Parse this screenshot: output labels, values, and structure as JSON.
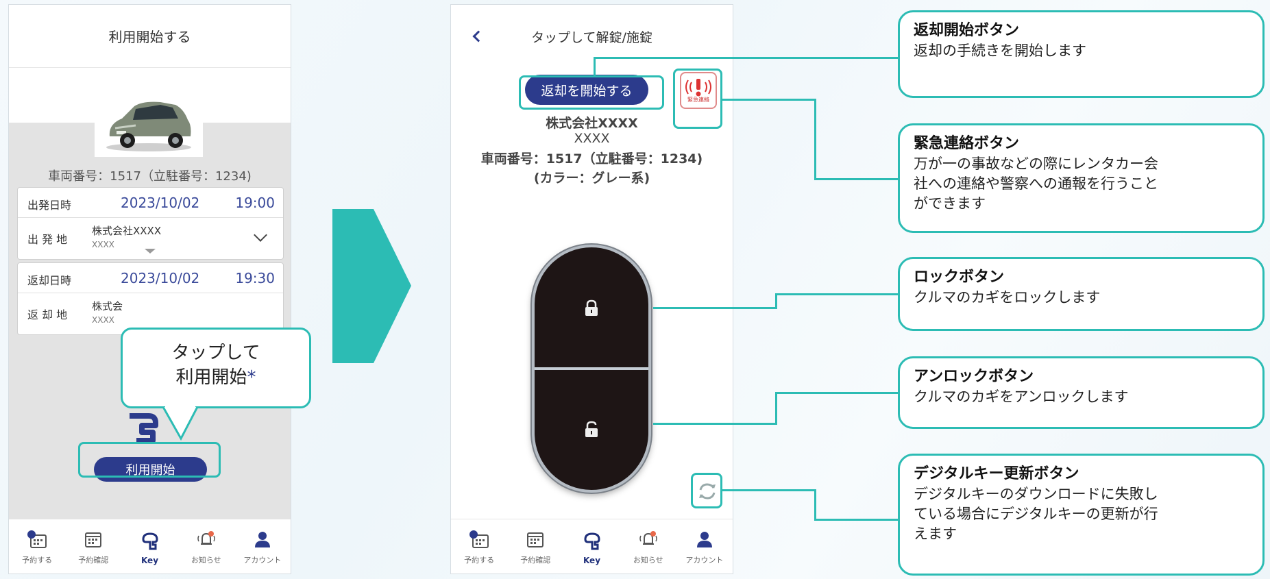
{
  "screen1": {
    "title": "利用開始する",
    "vehicle_number": "車両番号：1517（立駐番号：1234)",
    "departure": {
      "label_datetime": "出発日時",
      "date": "2023/10/02",
      "time": "19:00",
      "label_place": "出 発 地",
      "place": "株式会社XXXX",
      "place_sub": "XXXX"
    },
    "return": {
      "label_datetime": "返却日時",
      "date": "2023/10/02",
      "time": "19:30",
      "label_place": "返 却 地",
      "place": "株式会",
      "place_sub": "XXXX"
    },
    "start_button": "利用開始",
    "bubble_line1": "タップして",
    "bubble_line2": "利用開始",
    "bubble_mark": "*"
  },
  "screen2": {
    "title": "タップして解錠/施錠",
    "return_button": "返却を開始する",
    "emergency_label": "緊急連絡",
    "company": "株式会社XXXX",
    "company_sub": "XXXX",
    "vehicle_number": "車両番号：1517（立駐番号：1234)",
    "color": "(カラー：グレー系)"
  },
  "tabs": [
    {
      "label": "予約する",
      "icon": "calendar-clock-icon"
    },
    {
      "label": "予約確認",
      "icon": "calendar-icon"
    },
    {
      "label": "Key",
      "icon": "key-icon"
    },
    {
      "label": "お知らせ",
      "icon": "bell-icon"
    },
    {
      "label": "アカウント",
      "icon": "user-icon"
    }
  ],
  "descriptions": [
    {
      "title": "返却開始ボタン",
      "text": [
        "返却の手続きを開始します"
      ]
    },
    {
      "title": "緊急連絡ボタン",
      "text": [
        "万が一の事故などの際にレンタカー会",
        "社への連絡や警察への通報を行うこと",
        "ができます"
      ]
    },
    {
      "title": "ロックボタン",
      "text": [
        "クルマのカギをロックします"
      ]
    },
    {
      "title": "アンロックボタン",
      "text": [
        "クルマのカギをアンロックします"
      ]
    },
    {
      "title": "デジタルキー更新ボタン",
      "text": [
        "デジタルキーのダウンロードに失敗し",
        "ている場合にデジタルキーの更新が行",
        "えます"
      ]
    }
  ],
  "colors": {
    "accent": "#2cbcb4",
    "primary": "#2c3b8c",
    "key_body": "#1e1515"
  }
}
